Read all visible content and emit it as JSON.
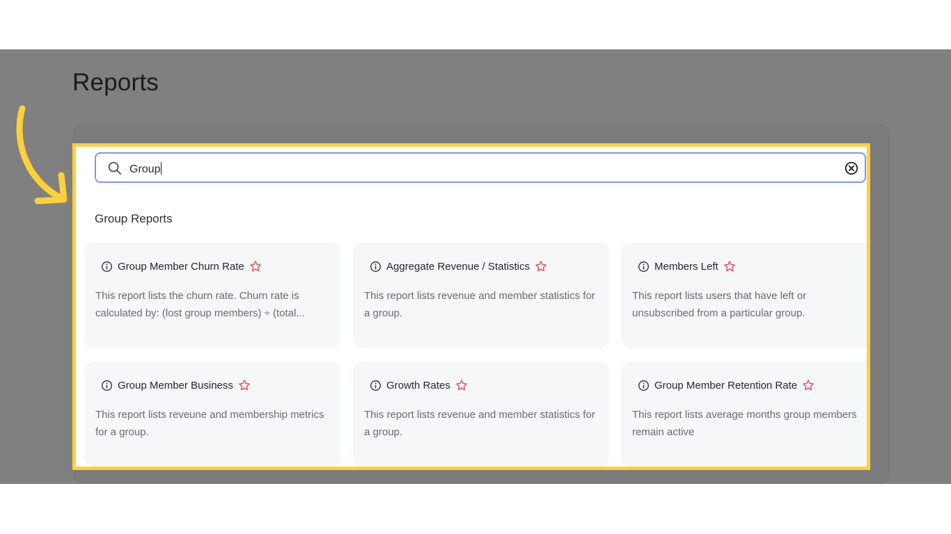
{
  "page": {
    "title": "Reports"
  },
  "search": {
    "value": "Group",
    "search_icon": "search-icon",
    "clear_icon": "clear-circle-x-icon"
  },
  "section": {
    "title": "Group Reports"
  },
  "cards": [
    {
      "title": "Group Member Churn Rate",
      "description": "This report lists the churn rate. Churn rate is calculated by: (lost group members) ÷ (total..."
    },
    {
      "title": "Aggregate Revenue / Statistics",
      "description": "This report lists revenue and member statistics for a group."
    },
    {
      "title": "Members Left",
      "description": "This report lists users that have left or unsubscribed from a particular group."
    },
    {
      "title": "Group Member Business",
      "description": "This report lists reveune and membership metrics for a group."
    },
    {
      "title": "Growth Rates",
      "description": "This report lists revenue and member statistics for a group."
    },
    {
      "title": "Group Member Retention Rate",
      "description": "This report lists average months group members remain active"
    }
  ],
  "icons": {
    "info": "info-circle-icon",
    "favorite": "star-outline-icon",
    "annotation": "curved-arrow-icon"
  },
  "colors": {
    "highlight_border": "#fdd13b",
    "overlay": "#808080",
    "search_border": "#7f94e6",
    "favorite_star": "#e5484d",
    "card_background": "#f6f7f9"
  }
}
